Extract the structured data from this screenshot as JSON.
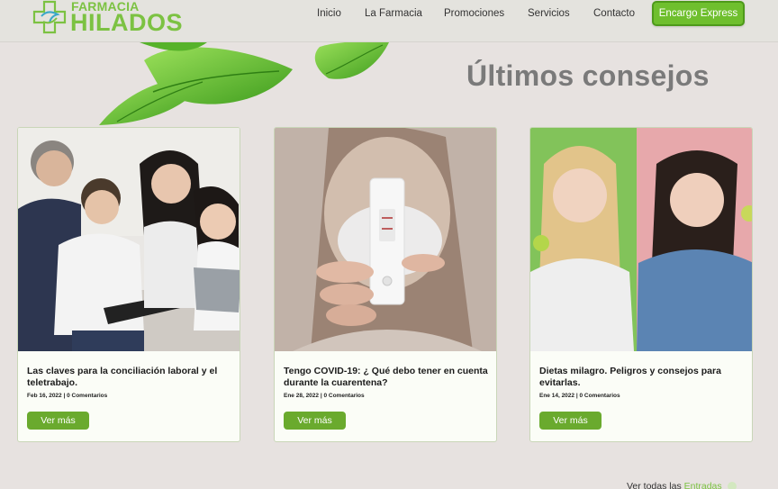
{
  "brand": {
    "top": "FARMACIA",
    "main": "HILADOS",
    "accent": "#7cc242"
  },
  "nav": {
    "items": [
      {
        "label": "Inicio"
      },
      {
        "label": "La Farmacia"
      },
      {
        "label": "Promociones"
      },
      {
        "label": "Servicios"
      },
      {
        "label": "Contacto"
      }
    ],
    "cta": "Encargo Express"
  },
  "section": {
    "title": "Últimos consejos"
  },
  "posts": [
    {
      "title": "Las claves para la conciliación laboral y el teletrabajo.",
      "meta": "Feb 16, 2022 | 0 Comentarios",
      "button": "Ver más",
      "image": "family-with-tablets-photo"
    },
    {
      "title": "Tengo COVID-19: ¿ Qué debo tener en cuenta durante la cuarentena?",
      "meta": "Ene 28, 2022 | 0 Comentarios",
      "button": "Ver más",
      "image": "covid-test-photo"
    },
    {
      "title": "Dietas milagro. Peligros y consejos para evitarlas.",
      "meta": "Ene 14, 2022 | 0 Comentarios",
      "button": "Ver más",
      "image": "women-eating-apples-photo"
    }
  ],
  "footer": {
    "see_all_prefix": "Ver todas las",
    "see_all_link": "Entradas"
  }
}
